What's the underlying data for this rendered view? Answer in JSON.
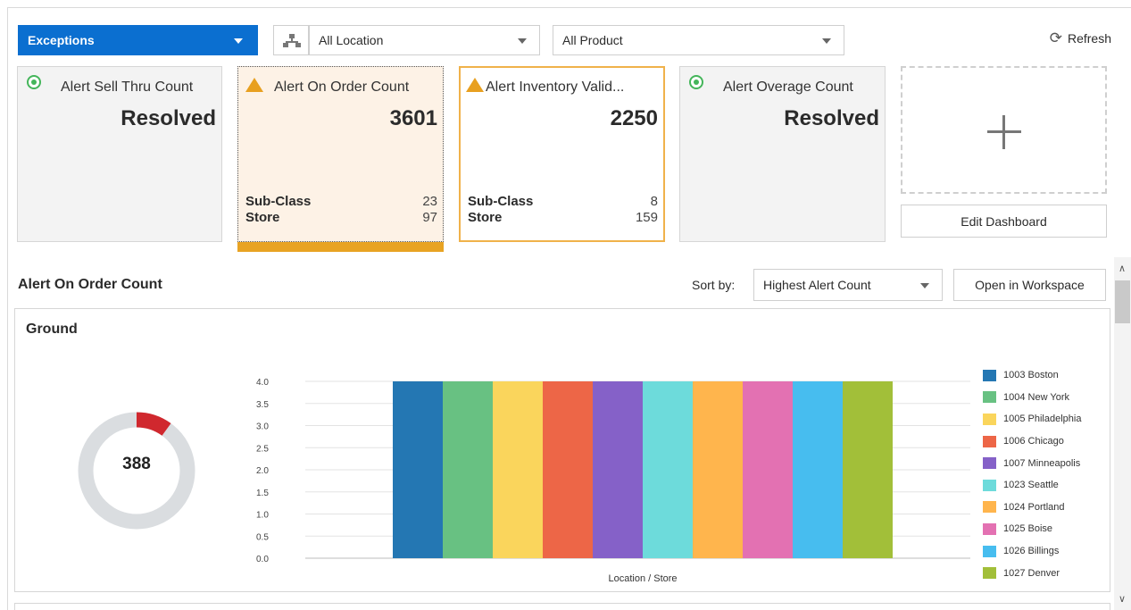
{
  "toolbar": {
    "view_select": "Exceptions",
    "location_select": "All Location",
    "product_select": "All Product",
    "refresh_label": "Refresh"
  },
  "tiles": [
    {
      "title": "Alert Sell Thru Count",
      "value": "Resolved",
      "status": "resolved"
    },
    {
      "title": "Alert On Order Count",
      "value": "3601",
      "status": "warning",
      "selected": true,
      "rows": [
        {
          "label": "Sub-Class",
          "value": "23"
        },
        {
          "label": "Store",
          "value": "97"
        }
      ]
    },
    {
      "title": "Alert Inventory Valid...",
      "value": "2250",
      "status": "warning",
      "rows": [
        {
          "label": "Sub-Class",
          "value": "8"
        },
        {
          "label": "Store",
          "value": "159"
        }
      ]
    },
    {
      "title": "Alert Overage Count",
      "value": "Resolved",
      "status": "resolved"
    }
  ],
  "edit_dashboard_label": "Edit Dashboard",
  "detail": {
    "title": "Alert On Order Count",
    "sort_label": "Sort by:",
    "sort_value": "Highest Alert Count",
    "open_workspace_label": "Open in Workspace",
    "panel_title": "Ground",
    "donut": {
      "value": "388",
      "fraction": 0.1,
      "color_filled": "#d0282e",
      "color_track": "#dadde0"
    }
  },
  "chart_data": {
    "type": "bar",
    "xlabel": "Location / Store",
    "ylabel": "",
    "ylim": [
      0,
      4.0
    ],
    "yticks": [
      "0.0",
      "0.5",
      "1.0",
      "1.5",
      "2.0",
      "2.5",
      "3.0",
      "3.5",
      "4.0"
    ],
    "legend_position": "right",
    "grid": true,
    "series": [
      {
        "name": "1003 Boston",
        "value": 4,
        "color": "#2477b3"
      },
      {
        "name": "1004 New York",
        "value": 4,
        "color": "#68c182"
      },
      {
        "name": "1005 Philadelphia",
        "value": 4,
        "color": "#fad55c"
      },
      {
        "name": "1006 Chicago",
        "value": 4,
        "color": "#ed6647"
      },
      {
        "name": "1007 Minneapolis",
        "value": 4,
        "color": "#8561c8"
      },
      {
        "name": "1023 Seattle",
        "value": 4,
        "color": "#6ddbdb"
      },
      {
        "name": "1024 Portland",
        "value": 4,
        "color": "#ffb54d"
      },
      {
        "name": "1025 Boise",
        "value": 4,
        "color": "#e371b2"
      },
      {
        "name": "1026 Billings",
        "value": 4,
        "color": "#47bdef"
      },
      {
        "name": "1027 Denver",
        "value": 4,
        "color": "#a2bf39"
      }
    ]
  }
}
